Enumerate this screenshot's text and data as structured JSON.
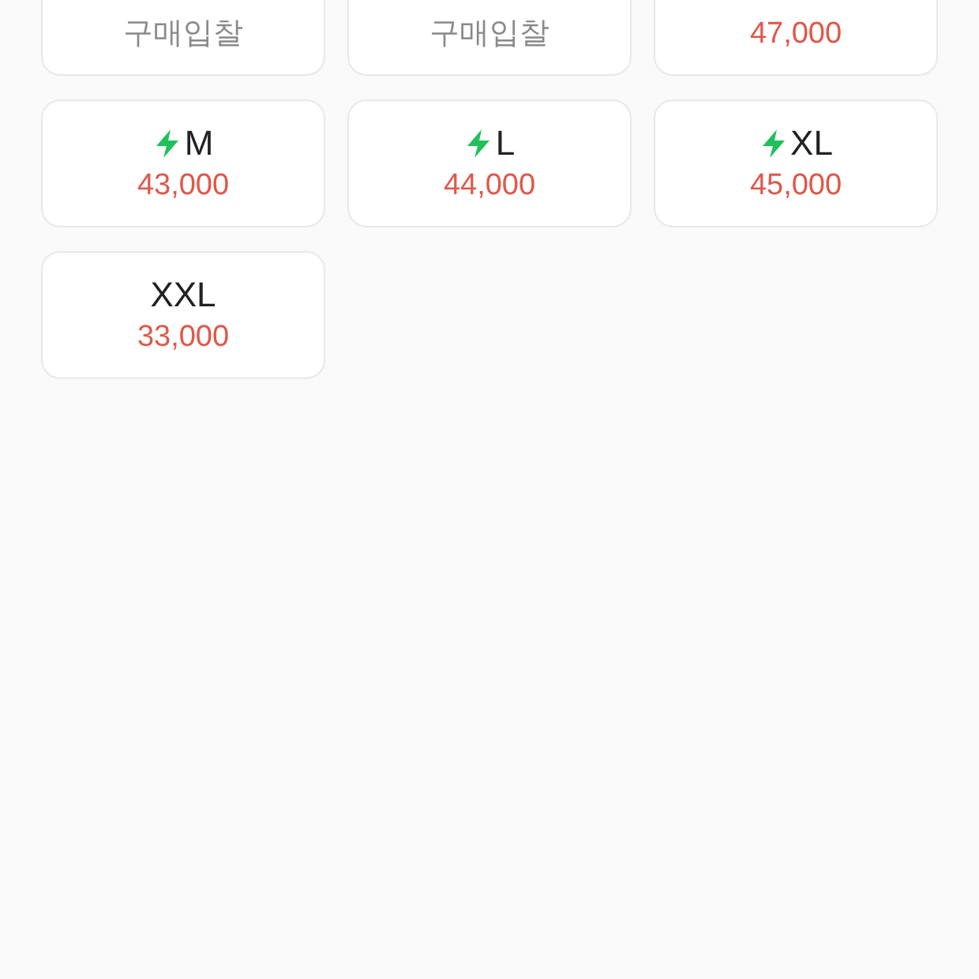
{
  "sizes": [
    {
      "express": false,
      "kind": "bid",
      "price": "구매입찰"
    },
    {
      "express": false,
      "kind": "bid",
      "price": "구매입찰"
    },
    {
      "express": false,
      "kind": "price",
      "price": "47,000"
    },
    {
      "size": "M",
      "express": true,
      "kind": "price",
      "price": "43,000"
    },
    {
      "size": "L",
      "express": true,
      "kind": "price",
      "price": "44,000"
    },
    {
      "size": "XL",
      "express": true,
      "kind": "price",
      "price": "45,000"
    },
    {
      "size": "XXL",
      "express": false,
      "kind": "price",
      "price": "33,000"
    }
  ]
}
